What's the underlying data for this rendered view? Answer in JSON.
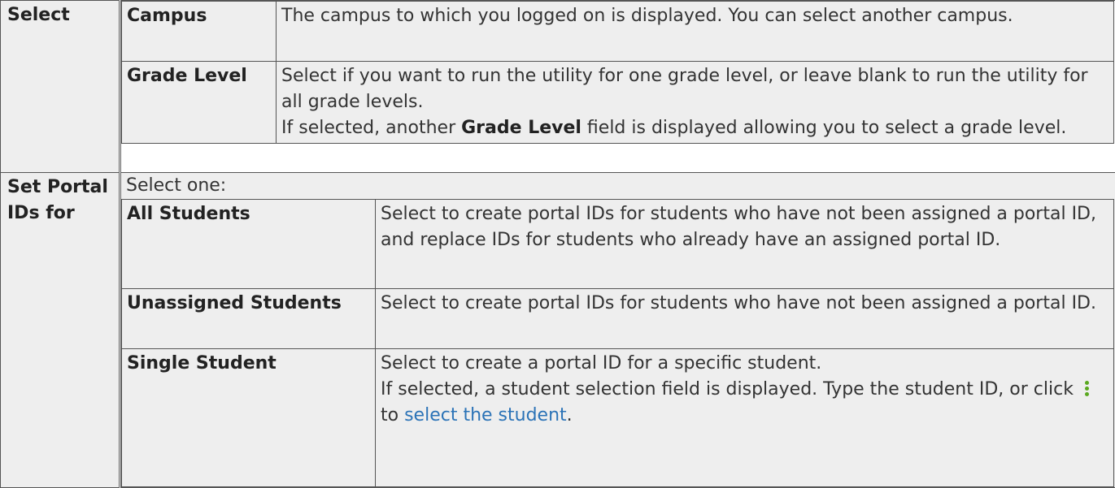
{
  "select_section": {
    "label": "Select",
    "rows": [
      {
        "term": "Campus",
        "desc": "The campus to which you logged on is displayed. You can select another campus."
      },
      {
        "term": "Grade Level",
        "desc_line1": "Select if you want to run the utility for one grade level, or leave blank to run the utility for all grade levels.",
        "desc_line2_pre": "If selected, another ",
        "desc_line2_bold": "Grade Level",
        "desc_line2_post": " field is displayed allowing you to select a grade level."
      }
    ]
  },
  "portal_section": {
    "label": "Set Portal IDs for",
    "intro": "Select one:",
    "rows": [
      {
        "term": "All Students",
        "desc": "Select to create portal IDs for students who have not been assigned a portal ID, and replace IDs for students who already have an assigned portal ID."
      },
      {
        "term": "Unassigned Students",
        "desc": "Select to create portal IDs for students who have not been assigned a portal ID."
      },
      {
        "term": "Single Student",
        "desc_line1": "Select to create a portal ID for a specific student.",
        "desc_line2_pre": "If selected, a student selection field is displayed. Type the student ID, or click ",
        "desc_line2_mid": " to ",
        "link_text": "select the student",
        "desc_line2_end": "."
      }
    ]
  },
  "icons": {
    "kebab": "vertical-dots-icon",
    "kebab_color": "#5aa820"
  },
  "colors": {
    "cell_bg": "#eeeeee",
    "border": "#555555",
    "link": "#2b73b7"
  }
}
